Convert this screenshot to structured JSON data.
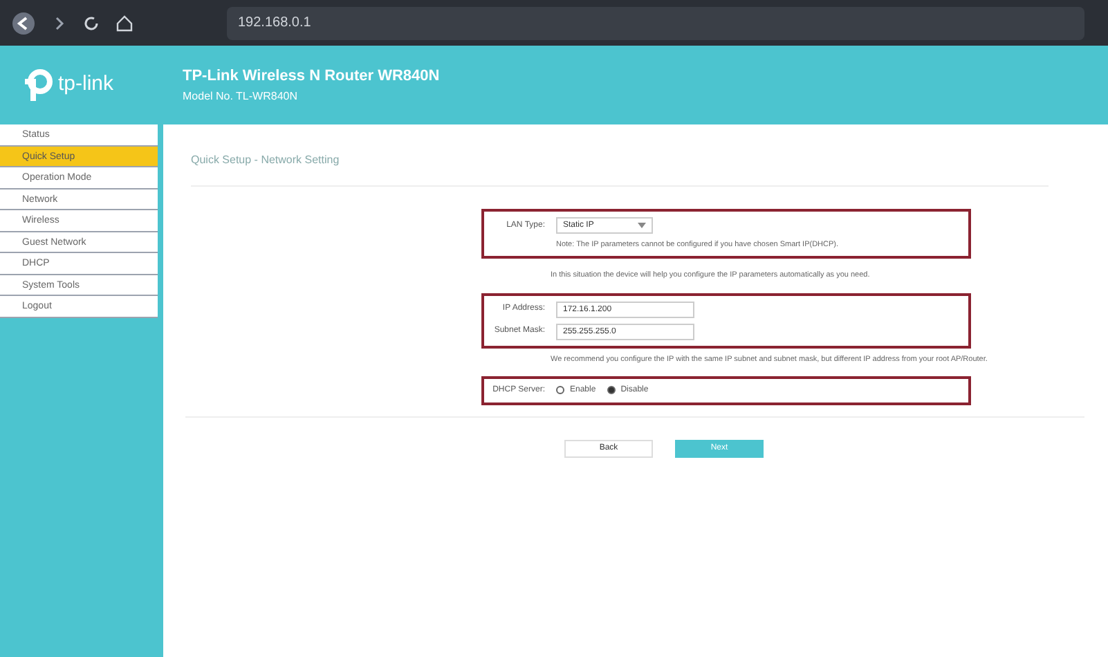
{
  "browser": {
    "url": "192.168.0.1"
  },
  "header": {
    "logo_text": "tp-link",
    "title": "TP-Link Wireless N Router WR840N",
    "model": "Model No. TL-WR840N"
  },
  "sidebar": {
    "items": [
      {
        "label": "Status",
        "selected": false
      },
      {
        "label": "Quick Setup",
        "selected": true
      },
      {
        "label": "Operation Mode",
        "selected": false
      },
      {
        "label": "Network",
        "selected": false
      },
      {
        "label": "Wireless",
        "selected": false
      },
      {
        "label": "Guest Network",
        "selected": false
      },
      {
        "label": "DHCP",
        "selected": false
      },
      {
        "label": "System Tools",
        "selected": false
      },
      {
        "label": "Logout",
        "selected": false
      }
    ]
  },
  "page_title": "Quick Setup - Network Setting",
  "lan": {
    "label": "LAN Type:",
    "value": "Static IP",
    "note": "Note: The IP parameters cannot be configured if you have chosen Smart IP(DHCP)."
  },
  "info": "In this situation the device will help you configure the IP parameters automatically as you need.",
  "ip": {
    "label": "IP Address:",
    "value": "172.16.1.200"
  },
  "mask": {
    "label": "Subnet Mask:",
    "value": "255.255.255.0"
  },
  "recommend": "We recommend you configure the IP with the same IP subnet and subnet mask, but different IP address from your root AP/Router.",
  "dhcp": {
    "label": "DHCP Server:",
    "options": [
      {
        "label": "Enable",
        "selected": false
      },
      {
        "label": "Disable",
        "selected": true
      }
    ]
  },
  "buttons": [
    {
      "label": "Back",
      "kind": "secondary"
    },
    {
      "label": "Next",
      "kind": "primary"
    }
  ]
}
